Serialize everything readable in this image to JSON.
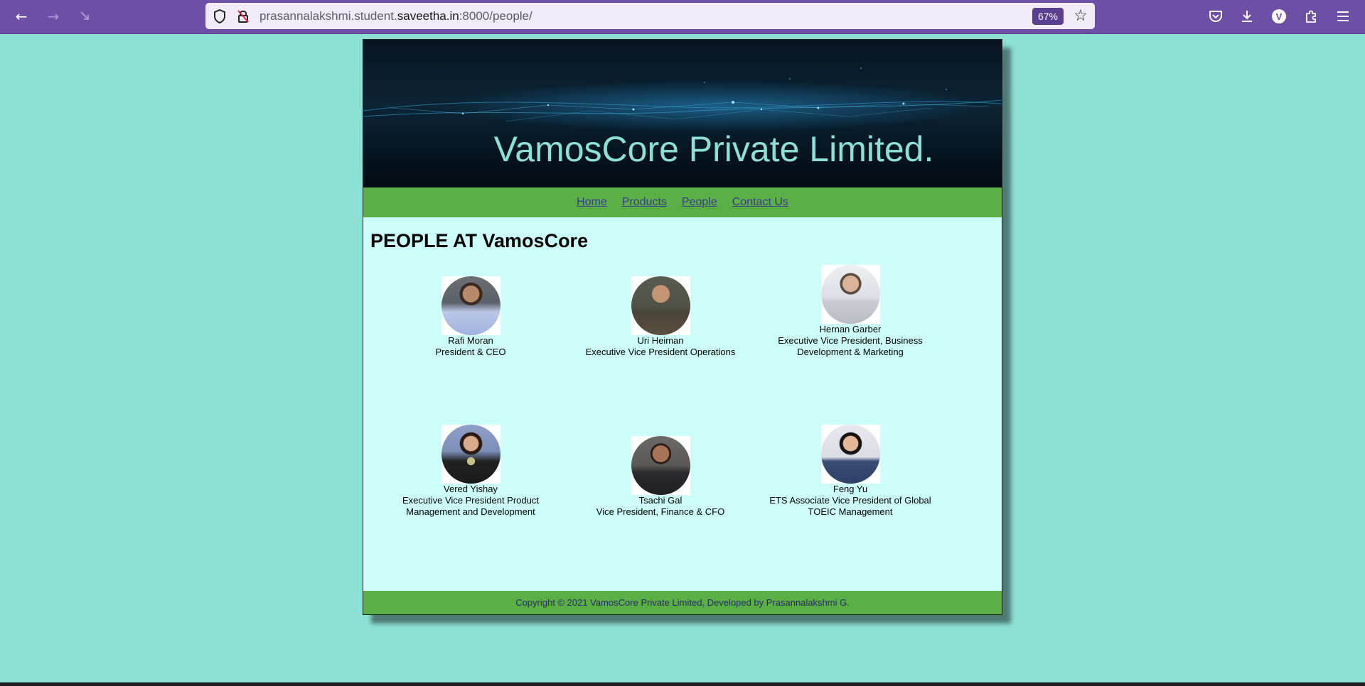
{
  "browser": {
    "url_prefix": "prasannalakshmi.student.",
    "url_domain": "saveetha.in",
    "url_suffix": ":8000/people/",
    "zoom": "67%",
    "profile_initial": "V"
  },
  "site": {
    "title": "VamosCore Private Limited.",
    "nav": [
      "Home",
      "Products",
      "People",
      "Contact Us"
    ],
    "heading": "PEOPLE AT VamosCore",
    "footer": "Copyright © 2021 VamosCore Private Limited, Developed by Prasannalakshmi G."
  },
  "people": [
    {
      "name": "Rafi Moran",
      "role": "President & CEO"
    },
    {
      "name": "Uri Heiman",
      "role": "Executive Vice President Operations"
    },
    {
      "name": "Hernan Garber",
      "role": "Executive Vice President, Business Development & Marketing"
    },
    {
      "name": "Vered Yishay",
      "role": "Executive Vice President Product Management and Development"
    },
    {
      "name": "Tsachi Gal",
      "role": "Vice President, Finance & CFO"
    },
    {
      "name": "Feng Yu",
      "role": "ETS Associate Vice President of Global TOEIC Management"
    }
  ]
}
